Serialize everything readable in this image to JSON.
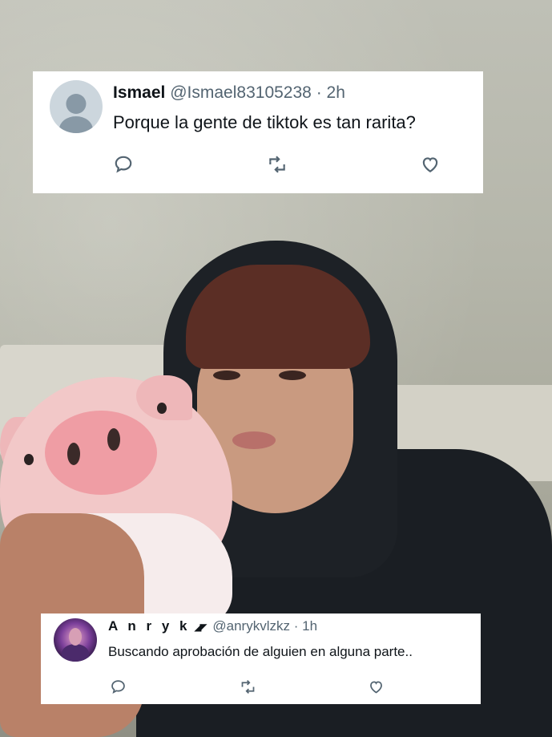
{
  "tweets": [
    {
      "name": "Ismael",
      "handle": "@Ismael83105238",
      "separator": "·",
      "time": "2h",
      "text": "Porque la gente de tiktok es tan rarita?",
      "avatar": "default-profile-icon"
    },
    {
      "name": "A n r y k",
      "handle": "@anrykvlzkz",
      "separator": "·",
      "time": "1h",
      "text": "Buscando aprobación de alguien en alguna parte..",
      "avatar": "profile-photo"
    }
  ],
  "actions": {
    "reply": "reply-icon",
    "retweet": "retweet-icon",
    "like": "heart-icon"
  },
  "colors": {
    "card_background": "#ffffff",
    "text_primary": "#0f1419",
    "text_secondary": "#536471",
    "icon": "#536471"
  }
}
